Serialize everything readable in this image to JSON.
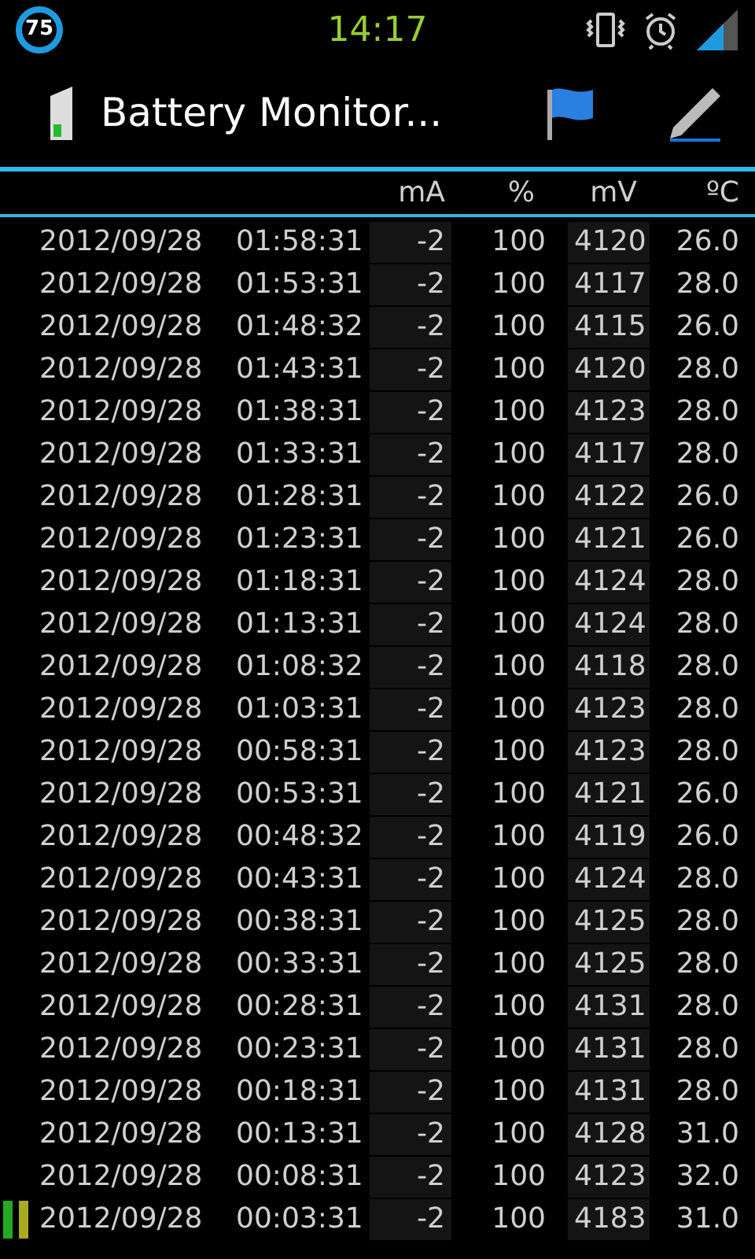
{
  "status_bar": {
    "battery": "75",
    "time": "14:17"
  },
  "action_bar": {
    "title": "Battery Monitor..."
  },
  "table": {
    "columns": [
      "mA",
      "%",
      "mV",
      "ºC"
    ],
    "rows": [
      {
        "date": "2012/09/28",
        "time": "01:58:31",
        "ma": "-2",
        "pct": "100",
        "mv": "4120",
        "temp": "26.0",
        "marked": false
      },
      {
        "date": "2012/09/28",
        "time": "01:53:31",
        "ma": "-2",
        "pct": "100",
        "mv": "4117",
        "temp": "28.0",
        "marked": false
      },
      {
        "date": "2012/09/28",
        "time": "01:48:32",
        "ma": "-2",
        "pct": "100",
        "mv": "4115",
        "temp": "26.0",
        "marked": false
      },
      {
        "date": "2012/09/28",
        "time": "01:43:31",
        "ma": "-2",
        "pct": "100",
        "mv": "4120",
        "temp": "28.0",
        "marked": false
      },
      {
        "date": "2012/09/28",
        "time": "01:38:31",
        "ma": "-2",
        "pct": "100",
        "mv": "4123",
        "temp": "28.0",
        "marked": false
      },
      {
        "date": "2012/09/28",
        "time": "01:33:31",
        "ma": "-2",
        "pct": "100",
        "mv": "4117",
        "temp": "28.0",
        "marked": false
      },
      {
        "date": "2012/09/28",
        "time": "01:28:31",
        "ma": "-2",
        "pct": "100",
        "mv": "4122",
        "temp": "26.0",
        "marked": false
      },
      {
        "date": "2012/09/28",
        "time": "01:23:31",
        "ma": "-2",
        "pct": "100",
        "mv": "4121",
        "temp": "26.0",
        "marked": false
      },
      {
        "date": "2012/09/28",
        "time": "01:18:31",
        "ma": "-2",
        "pct": "100",
        "mv": "4124",
        "temp": "28.0",
        "marked": false
      },
      {
        "date": "2012/09/28",
        "time": "01:13:31",
        "ma": "-2",
        "pct": "100",
        "mv": "4124",
        "temp": "28.0",
        "marked": false
      },
      {
        "date": "2012/09/28",
        "time": "01:08:32",
        "ma": "-2",
        "pct": "100",
        "mv": "4118",
        "temp": "28.0",
        "marked": false
      },
      {
        "date": "2012/09/28",
        "time": "01:03:31",
        "ma": "-2",
        "pct": "100",
        "mv": "4123",
        "temp": "28.0",
        "marked": false
      },
      {
        "date": "2012/09/28",
        "time": "00:58:31",
        "ma": "-2",
        "pct": "100",
        "mv": "4123",
        "temp": "28.0",
        "marked": false
      },
      {
        "date": "2012/09/28",
        "time": "00:53:31",
        "ma": "-2",
        "pct": "100",
        "mv": "4121",
        "temp": "26.0",
        "marked": false
      },
      {
        "date": "2012/09/28",
        "time": "00:48:32",
        "ma": "-2",
        "pct": "100",
        "mv": "4119",
        "temp": "26.0",
        "marked": false
      },
      {
        "date": "2012/09/28",
        "time": "00:43:31",
        "ma": "-2",
        "pct": "100",
        "mv": "4124",
        "temp": "28.0",
        "marked": false
      },
      {
        "date": "2012/09/28",
        "time": "00:38:31",
        "ma": "-2",
        "pct": "100",
        "mv": "4125",
        "temp": "28.0",
        "marked": false
      },
      {
        "date": "2012/09/28",
        "time": "00:33:31",
        "ma": "-2",
        "pct": "100",
        "mv": "4125",
        "temp": "28.0",
        "marked": false
      },
      {
        "date": "2012/09/28",
        "time": "00:28:31",
        "ma": "-2",
        "pct": "100",
        "mv": "4131",
        "temp": "28.0",
        "marked": false
      },
      {
        "date": "2012/09/28",
        "time": "00:23:31",
        "ma": "-2",
        "pct": "100",
        "mv": "4131",
        "temp": "28.0",
        "marked": false
      },
      {
        "date": "2012/09/28",
        "time": "00:18:31",
        "ma": "-2",
        "pct": "100",
        "mv": "4131",
        "temp": "28.0",
        "marked": false
      },
      {
        "date": "2012/09/28",
        "time": "00:13:31",
        "ma": "-2",
        "pct": "100",
        "mv": "4128",
        "temp": "31.0",
        "marked": false
      },
      {
        "date": "2012/09/28",
        "time": "00:08:31",
        "ma": "-2",
        "pct": "100",
        "mv": "4123",
        "temp": "32.0",
        "marked": false
      },
      {
        "date": "2012/09/28",
        "time": "00:03:31",
        "ma": "-2",
        "pct": "100",
        "mv": "4183",
        "temp": "31.0",
        "marked": true
      }
    ]
  }
}
